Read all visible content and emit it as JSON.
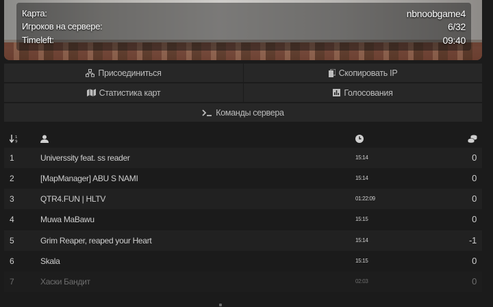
{
  "server_info": {
    "map_label": "Карта:",
    "map_value": "nbnoobgame4",
    "players_label": "Игроков на сервере:",
    "players_value": "6/32",
    "timeleft_label": "Timeleft:",
    "timeleft_value": "09:40"
  },
  "buttons": {
    "join": "Присоединиться",
    "copy_ip": "Скопировать IP",
    "map_stats": "Статистика карт",
    "votes": "Голосования",
    "commands": "Команды сервера"
  },
  "table": {
    "columns": [
      {
        "name": "rank",
        "icon": "sort-numeric-icon"
      },
      {
        "name": "player",
        "icon": "user-icon"
      },
      {
        "name": "time",
        "icon": "clock-icon"
      },
      {
        "name": "score",
        "icon": "coins-icon"
      }
    ],
    "rows": [
      {
        "rank": "1",
        "name": "Universsity feat. ss reader",
        "time": "15:14",
        "score": "0"
      },
      {
        "rank": "2",
        "name": "[MapManager] ABU S NAMI",
        "time": "15:14",
        "score": "0"
      },
      {
        "rank": "3",
        "name": "QTR4.FUN | HLTV",
        "time": "01:22:09",
        "score": "0"
      },
      {
        "rank": "4",
        "name": "Muwa MaBawu",
        "time": "15:15",
        "score": "0"
      },
      {
        "rank": "5",
        "name": "Grim Reaper, reaped your Heart",
        "time": "15:14",
        "score": "-1"
      },
      {
        "rank": "6",
        "name": "Skala",
        "time": "15:15",
        "score": "0"
      },
      {
        "rank": "7",
        "name": "Хаски Бандит",
        "time": "02:03",
        "score": "0"
      }
    ]
  }
}
